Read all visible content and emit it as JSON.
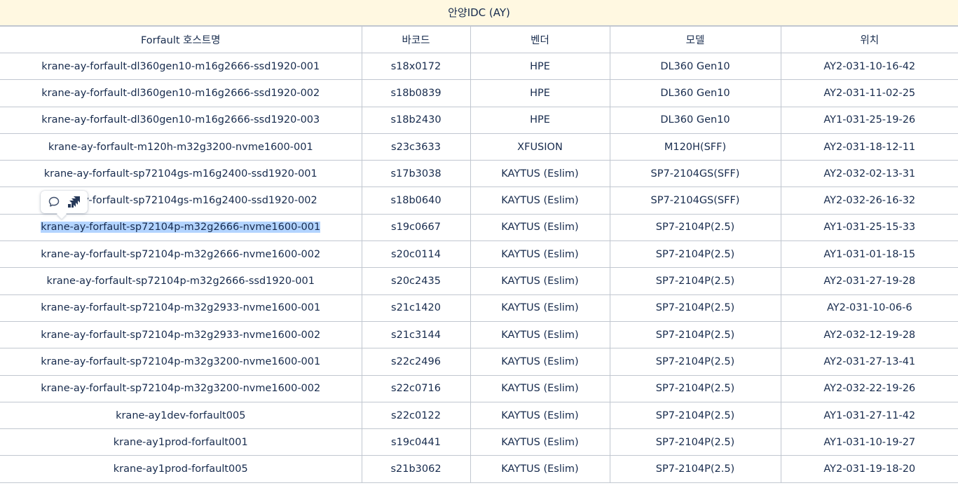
{
  "banner": {
    "title": "안양IDC (AY)"
  },
  "table": {
    "headers": [
      "Forfault 호스트명",
      "바코드",
      "벤더",
      "모델",
      "위치"
    ],
    "rows": [
      [
        "krane-ay-forfault-dl360gen10-m16g2666-ssd1920-001",
        "s18x0172",
        "HPE",
        "DL360 Gen10",
        "AY2-031-10-16-42"
      ],
      [
        "krane-ay-forfault-dl360gen10-m16g2666-ssd1920-002",
        "s18b0839",
        "HPE",
        "DL360 Gen10",
        "AY2-031-11-02-25"
      ],
      [
        "krane-ay-forfault-dl360gen10-m16g2666-ssd1920-003",
        "s18b2430",
        "HPE",
        "DL360 Gen10",
        "AY1-031-25-19-26"
      ],
      [
        "krane-ay-forfault-m120h-m32g3200-nvme1600-001",
        "s23c3633",
        "XFUSION",
        "M120H(SFF)",
        "AY2-031-18-12-11"
      ],
      [
        "krane-ay-forfault-sp72104gs-m16g2400-ssd1920-001",
        "s17b3038",
        "KAYTUS (Eslim)",
        "SP7-2104GS(SFF)",
        "AY2-032-02-13-31"
      ],
      [
        "krane-ay-forfault-sp72104gs-m16g2400-ssd1920-002",
        "s18b0640",
        "KAYTUS (Eslim)",
        "SP7-2104GS(SFF)",
        "AY2-032-26-16-32"
      ],
      [
        "krane-ay-forfault-sp72104p-m32g2666-nvme1600-001",
        "s19c0667",
        "KAYTUS (Eslim)",
        "SP7-2104P(2.5)",
        "AY1-031-25-15-33"
      ],
      [
        "krane-ay-forfault-sp72104p-m32g2666-nvme1600-002",
        "s20c0114",
        "KAYTUS (Eslim)",
        "SP7-2104P(2.5)",
        "AY1-031-01-18-15"
      ],
      [
        "krane-ay-forfault-sp72104p-m32g2666-ssd1920-001",
        "s20c2435",
        "KAYTUS (Eslim)",
        "SP7-2104P(2.5)",
        "AY2-031-27-19-28"
      ],
      [
        "krane-ay-forfault-sp72104p-m32g2933-nvme1600-001",
        "s21c1420",
        "KAYTUS (Eslim)",
        "SP7-2104P(2.5)",
        "AY2-031-10-06-6"
      ],
      [
        "krane-ay-forfault-sp72104p-m32g2933-nvme1600-002",
        "s21c3144",
        "KAYTUS (Eslim)",
        "SP7-2104P(2.5)",
        "AY2-032-12-19-28"
      ],
      [
        "krane-ay-forfault-sp72104p-m32g3200-nvme1600-001",
        "s22c2496",
        "KAYTUS (Eslim)",
        "SP7-2104P(2.5)",
        "AY2-031-27-13-41"
      ],
      [
        "krane-ay-forfault-sp72104p-m32g3200-nvme1600-002",
        "s22c0716",
        "KAYTUS (Eslim)",
        "SP7-2104P(2.5)",
        "AY2-032-22-19-26"
      ],
      [
        "krane-ay1dev-forfault005",
        "s22c0122",
        "KAYTUS (Eslim)",
        "SP7-2104P(2.5)",
        "AY1-031-27-11-42"
      ],
      [
        "krane-ay1prod-forfault001",
        "s19c0441",
        "KAYTUS (Eslim)",
        "SP7-2104P(2.5)",
        "AY1-031-10-19-27"
      ],
      [
        "krane-ay1prod-forfault005",
        "s21b3062",
        "KAYTUS (Eslim)",
        "SP7-2104P(2.5)",
        "AY2-031-19-18-20"
      ]
    ],
    "selected_row": 6
  },
  "popup": {
    "icons": [
      "comment-icon",
      "jira-icon"
    ]
  },
  "colors": {
    "banner_bg": "#fff8e1",
    "border": "#c1c7d0",
    "text": "#172b4d",
    "selection": "#b3d4ff"
  }
}
